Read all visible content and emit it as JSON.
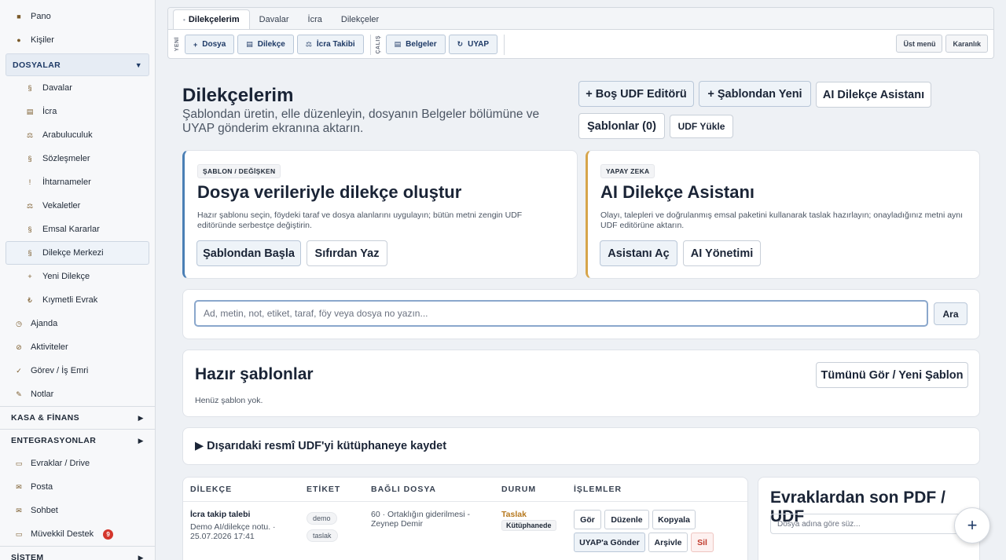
{
  "sidebar": {
    "top": [
      {
        "label": "Pano",
        "icon": "dashboard-icon",
        "glyph": "■"
      },
      {
        "label": "Kişiler",
        "icon": "people-icon",
        "glyph": "●"
      }
    ],
    "dosyalar_label": "DOSYALAR",
    "dosyalar": [
      {
        "label": "Davalar",
        "icon": "section-icon",
        "glyph": "§"
      },
      {
        "label": "İcra",
        "icon": "ledger-icon",
        "glyph": "▤"
      },
      {
        "label": "Arabuluculuk",
        "icon": "handshake-icon",
        "glyph": "⚖"
      },
      {
        "label": "Sözleşmeler",
        "icon": "section-icon",
        "glyph": "§"
      },
      {
        "label": "İhtarnameler",
        "icon": "exclamation-icon",
        "glyph": "!"
      },
      {
        "label": "Vekaletler",
        "icon": "handshake-icon",
        "glyph": "⚖"
      },
      {
        "label": "Emsal Kararlar",
        "icon": "section-icon",
        "glyph": "§"
      },
      {
        "label": "Dilekçe Merkezi",
        "icon": "section-icon",
        "glyph": "§"
      },
      {
        "label": "Yeni Dilekçe",
        "icon": "plus-icon",
        "glyph": "+"
      },
      {
        "label": "Kıymetli Evrak",
        "icon": "lira-icon",
        "glyph": "₺"
      }
    ],
    "middle": [
      {
        "label": "Ajanda",
        "icon": "clock-icon",
        "glyph": "◷"
      },
      {
        "label": "Aktiviteler",
        "icon": "activity-icon",
        "glyph": "⊘"
      },
      {
        "label": "Görev / İş Emri",
        "icon": "check-icon",
        "glyph": "✓"
      },
      {
        "label": "Notlar",
        "icon": "pencil-icon",
        "glyph": "✎"
      }
    ],
    "kasa_label": "KASA & FİNANS",
    "entegrasyon_label": "ENTEGRASYONLAR",
    "integrations": [
      {
        "label": "Evraklar / Drive",
        "icon": "folder-icon",
        "glyph": "▭"
      },
      {
        "label": "Posta",
        "icon": "mail-icon",
        "glyph": "✉"
      },
      {
        "label": "Sohbet",
        "icon": "chat-icon",
        "glyph": "✉"
      },
      {
        "label": "Müvekkil Destek",
        "icon": "support-icon",
        "glyph": "▭",
        "badge": "9"
      }
    ],
    "sistem_label": "SİSTEM"
  },
  "topbar": {
    "tabs": [
      "Dilekçelerim",
      "Davalar",
      "İcra",
      "Dilekçeler"
    ],
    "label_new": "YENİ",
    "label_work": "ÇALIŞ",
    "new_buttons": [
      {
        "label": "Dosya",
        "glyph": "+"
      },
      {
        "label": "Dilekçe",
        "glyph": "▤"
      },
      {
        "label": "İcra Takibi",
        "glyph": "⚖"
      }
    ],
    "work_buttons": [
      {
        "label": "Belgeler",
        "glyph": "▤"
      },
      {
        "label": "UYAP",
        "glyph": "↻"
      }
    ],
    "ust_menu": "Üst menü",
    "karanlik": "Karanlık"
  },
  "header": {
    "title": "Dilekçelerim",
    "subtitle": "Şablondan üretin, elle düzenleyin, dosyanın Belgeler bölümüne ve UYAP gönderim ekranına aktarın.",
    "btn_bos": "+  Boş UDF Editörü",
    "btn_sablondan": "+  Şablondan Yeni",
    "btn_ai": "AI Dilekçe Asistanı",
    "btn_sablonlar": "Şablonlar (0)",
    "btn_udf_yukle": "UDF Yükle"
  },
  "card_template": {
    "pill": "ŞABLON / DEĞİŞKEN",
    "title": "Dosya verileriyle dilekçe oluştur",
    "desc": "Hazır şablonu seçin, föydeki taraf ve dosya alanlarını uygulayın; bütün metni zengin UDF editöründe serbestçe değiştirin.",
    "btn_start": "Şablondan Başla",
    "btn_scratch": "Sıfırdan Yaz"
  },
  "card_ai": {
    "pill": "YAPAY ZEKA",
    "title": "AI Dilekçe Asistanı",
    "desc": "Olayı, talepleri ve doğrulanmış emsal paketini kullanarak taslak hazırlayın; onayladığınız metni aynı UDF editörüne aktarın.",
    "btn_open": "Asistanı Aç",
    "btn_manage": "AI Yönetimi"
  },
  "search": {
    "placeholder": "Ad, metin, not, etiket, taraf, föy veya dosya no yazın...",
    "button": "Ara"
  },
  "templates": {
    "title": "Hazır şablonlar",
    "empty": "Henüz şablon yok.",
    "btn_all": "Tümünü Gör / Yeni Şablon"
  },
  "save_external": {
    "label": "▶  Dışarıdaki resmî UDF'yi kütüphaneye kaydet"
  },
  "table": {
    "headers": [
      "DİLEKÇE",
      "ETİKET",
      "BAĞLI DOSYA",
      "DURUM",
      "İŞLEMLER"
    ],
    "row": {
      "title": "İcra takip talebi",
      "note": "Demo AI/dilekçe notu. · 25.07.2026 17:41",
      "tags": [
        "demo",
        "taslak"
      ],
      "file": "60 · Ortaklığın giderilmesi - Zeynep Demir",
      "status": "Taslak",
      "status_badge": "Kütüphanede",
      "actions": [
        "Gör",
        "Düzenle",
        "Kopyala",
        "UYAP'a Gönder",
        "Arşivle",
        "Sil"
      ]
    }
  },
  "recent": {
    "title": "Evraklardan son PDF / UDF",
    "placeholder": "Dosya adına göre süz..."
  },
  "fab": {
    "glyph": "+"
  },
  "colors": {
    "accent": "#1e3a66",
    "gold": "#d6a54b",
    "blue": "#4a7fb5",
    "danger": "#c0392b"
  }
}
